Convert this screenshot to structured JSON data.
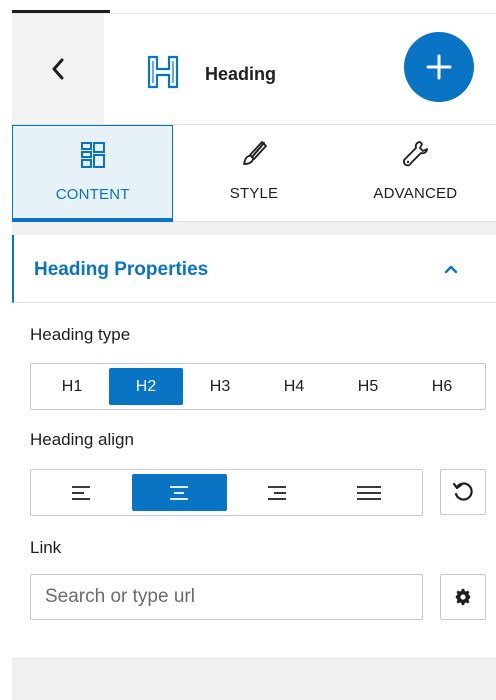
{
  "header": {
    "back_icon": "chevron-left-icon",
    "block_icon": "heading-icon",
    "title": "Heading",
    "add_icon": "plus-icon",
    "accent": "#0a74c4"
  },
  "tabs": [
    {
      "label": "CONTENT",
      "icon": "layout-grid-icon",
      "active": true
    },
    {
      "label": "STYLE",
      "icon": "paintbrush-icon",
      "active": false
    },
    {
      "label": "ADVANCED",
      "icon": "wrench-icon",
      "active": false
    }
  ],
  "section": {
    "title": "Heading Properties",
    "toggle_icon": "chevron-up-icon",
    "expanded": true
  },
  "heading_type": {
    "label": "Heading type",
    "options": [
      "H1",
      "H2",
      "H3",
      "H4",
      "H5",
      "H6"
    ],
    "selected": "H2"
  },
  "heading_align": {
    "label": "Heading align",
    "options": [
      "align-left-icon",
      "align-center-icon",
      "align-right-icon",
      "align-justify-icon"
    ],
    "selected": "align-center-icon",
    "reset_icon": "reset-icon"
  },
  "link": {
    "label": "Link",
    "placeholder": "Search or type url",
    "value": "",
    "settings_icon": "gear-icon"
  }
}
